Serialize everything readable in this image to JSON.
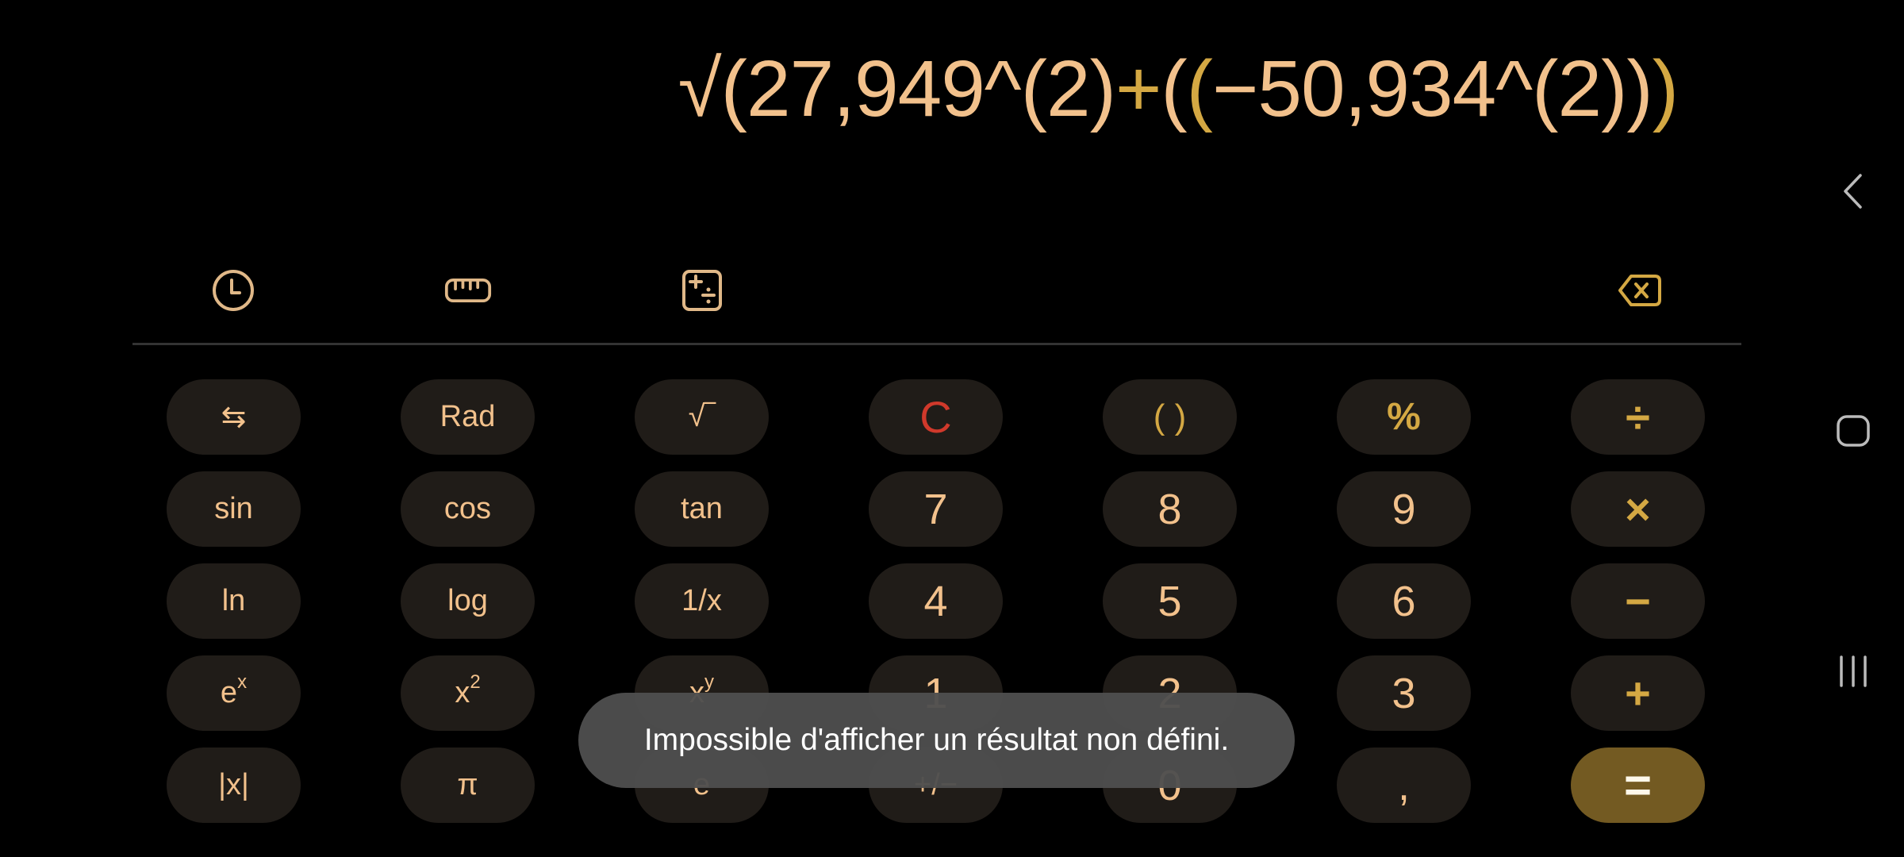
{
  "display": {
    "expression_parts": [
      {
        "text": "√(27,949^(2)",
        "accent": false
      },
      {
        "text": "+",
        "accent": true
      },
      {
        "text": "(",
        "accent": false
      },
      {
        "text": "(",
        "accent": true
      },
      {
        "text": "−50,934^(2))",
        "accent": false
      },
      {
        "text": ")",
        "accent": true
      }
    ]
  },
  "toolbar": {
    "history_icon": "clock-icon",
    "unit_converter_icon": "ruler-icon",
    "scientific_icon": "calculator-functions-icon",
    "backspace_icon": "backspace-icon"
  },
  "keypad": {
    "rows": [
      [
        {
          "label": "⇆",
          "name": "toggle-functions-button",
          "kind": "fn"
        },
        {
          "label": "Rad",
          "name": "rad-button",
          "kind": "fn"
        },
        {
          "label": "√‾",
          "name": "sqrt-button",
          "kind": "fn"
        },
        {
          "label": "C",
          "name": "clear-button",
          "kind": "clear"
        },
        {
          "label": "( )",
          "name": "parentheses-button",
          "kind": "paren"
        },
        {
          "label": "%",
          "name": "percent-button",
          "kind": "pct"
        },
        {
          "label": "÷",
          "name": "divide-button",
          "kind": "op"
        }
      ],
      [
        {
          "label": "sin",
          "name": "sin-button",
          "kind": "fn"
        },
        {
          "label": "cos",
          "name": "cos-button",
          "kind": "fn"
        },
        {
          "label": "tan",
          "name": "tan-button",
          "kind": "fn"
        },
        {
          "label": "7",
          "name": "digit-7-button",
          "kind": "num"
        },
        {
          "label": "8",
          "name": "digit-8-button",
          "kind": "num"
        },
        {
          "label": "9",
          "name": "digit-9-button",
          "kind": "num"
        },
        {
          "label": "×",
          "name": "multiply-button",
          "kind": "op"
        }
      ],
      [
        {
          "label": "ln",
          "name": "ln-button",
          "kind": "fn"
        },
        {
          "label": "log",
          "name": "log-button",
          "kind": "fn"
        },
        {
          "label": "1/x",
          "name": "reciprocal-button",
          "kind": "fn"
        },
        {
          "label": "4",
          "name": "digit-4-button",
          "kind": "num"
        },
        {
          "label": "5",
          "name": "digit-5-button",
          "kind": "num"
        },
        {
          "label": "6",
          "name": "digit-6-button",
          "kind": "num"
        },
        {
          "label": "−",
          "name": "subtract-button",
          "kind": "op"
        }
      ],
      [
        {
          "label": "e",
          "sup": "x",
          "name": "exp-button",
          "kind": "fn"
        },
        {
          "label": "x",
          "sup": "2",
          "name": "square-button",
          "kind": "fn"
        },
        {
          "label": "x",
          "sup": "y",
          "name": "power-button",
          "kind": "fn"
        },
        {
          "label": "1",
          "name": "digit-1-button",
          "kind": "num"
        },
        {
          "label": "2",
          "name": "digit-2-button",
          "kind": "num"
        },
        {
          "label": "3",
          "name": "digit-3-button",
          "kind": "num"
        },
        {
          "label": "+",
          "name": "add-button",
          "kind": "op"
        }
      ],
      [
        {
          "label": "|x|",
          "name": "abs-button",
          "kind": "fn"
        },
        {
          "label": "π",
          "name": "pi-button",
          "kind": "fn"
        },
        {
          "label": "e",
          "name": "euler-button",
          "kind": "fn"
        },
        {
          "label": "+/−",
          "name": "negate-button",
          "kind": "fn"
        },
        {
          "label": "0",
          "name": "digit-0-button",
          "kind": "num"
        },
        {
          "label": ",",
          "name": "decimal-button",
          "kind": "num"
        },
        {
          "label": "=",
          "name": "equals-button",
          "kind": "eq"
        }
      ]
    ]
  },
  "toast": {
    "message": "Impossible d'afficher un résultat non défini."
  },
  "navbar": {
    "back_icon": "back-icon",
    "home_icon": "home-icon",
    "recents_icon": "recents-icon"
  },
  "colors": {
    "text_primary": "#f2c18c",
    "accent": "#d4a843",
    "clear": "#d0392b",
    "key_bg": "#201c18",
    "equals_bg": "#735a22"
  }
}
